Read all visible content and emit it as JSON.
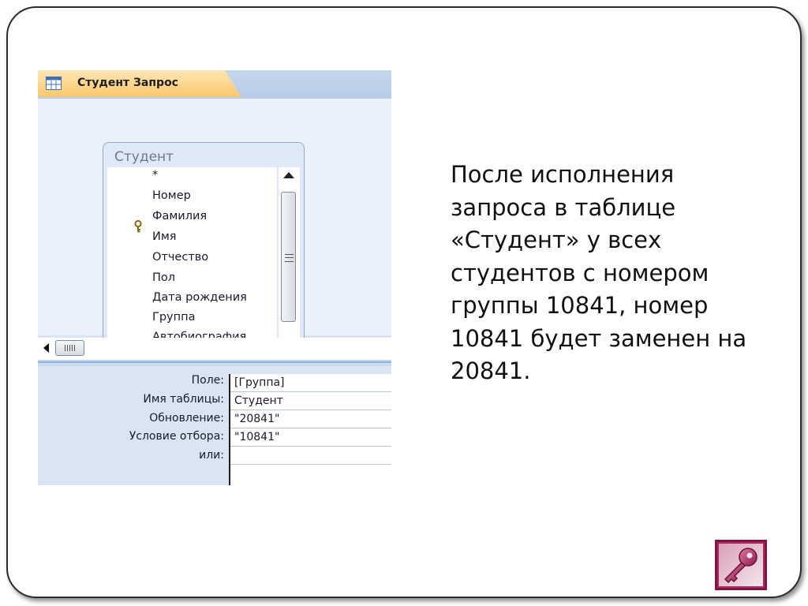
{
  "query_window": {
    "tab_label": "Студент Запрос",
    "table": {
      "title": "Студент",
      "fields": [
        "*",
        "Номер",
        "Фамилия",
        "Имя",
        "Отчество",
        "Пол",
        "Дата рождения",
        "Группа",
        "Автобиография"
      ],
      "primary_key_field": "Номер"
    },
    "grid": {
      "row_labels": {
        "field": "Поле:",
        "table_name": "Имя таблицы:",
        "update": "Обновление:",
        "criteria": "Условие отбора:",
        "or": "или:"
      },
      "column_1": {
        "field": "[Группа]",
        "table_name": "Студент",
        "update": "\"20841\"",
        "criteria": "\"10841\"",
        "or": ""
      }
    }
  },
  "slide_text": {
    "lines": [
      "После исполнения",
      "запроса в таблице",
      "«Студент» у всех",
      "студентов с номером",
      "группы 10841, номер",
      "10841 будет заменен на",
      "20841."
    ]
  },
  "icons": {
    "tab_icon": "query-icon",
    "key_icon": "primary-key-icon",
    "logo": "ms-access-key-logo"
  },
  "colors": {
    "tab_orange": "#fbc86d",
    "access_blue": "#d9e5f2",
    "logo_magenta": "#a8205c"
  }
}
